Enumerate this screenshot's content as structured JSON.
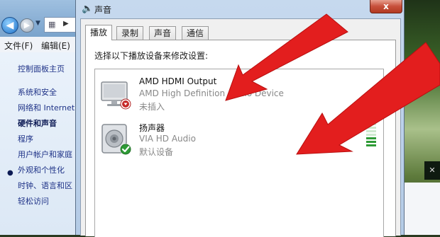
{
  "control_panel": {
    "menu": {
      "file": "文件(F)",
      "edit": "编辑(E)"
    },
    "nav_items": [
      {
        "label": "控制面板主页"
      },
      {
        "label": "系统和安全"
      },
      {
        "label": "网络和 Internet"
      },
      {
        "label": "硬件和声音"
      },
      {
        "label": "程序"
      },
      {
        "label": "用户帐户和家庭"
      },
      {
        "label": "外观和个性化"
      },
      {
        "label": "时钟、语言和区"
      },
      {
        "label": "轻松访问"
      }
    ],
    "active_nav": "硬件和声音"
  },
  "dialog": {
    "title": "声音",
    "close_glyph": "x",
    "tabs": [
      {
        "label": "播放"
      },
      {
        "label": "录制"
      },
      {
        "label": "声音"
      },
      {
        "label": "通信"
      }
    ],
    "active_tab": "播放",
    "instruction": "选择以下播放设备来修改设置:",
    "devices": [
      {
        "name": "AMD HDMI Output",
        "description": "AMD High Definition Audio Device",
        "status": "未插入",
        "icon": "monitor-icon",
        "badge": "unplugged-badge"
      },
      {
        "name": "扬声器",
        "description": "VIA HD Audio",
        "status": "默认设备",
        "icon": "speaker-icon",
        "badge": "default-check-badge",
        "level_bars_active": 3,
        "level_bars_total": 8
      }
    ]
  },
  "colors": {
    "arrow": "#e31e1e",
    "accent_green": "#2e9b36",
    "close_red": "#c7503b"
  }
}
